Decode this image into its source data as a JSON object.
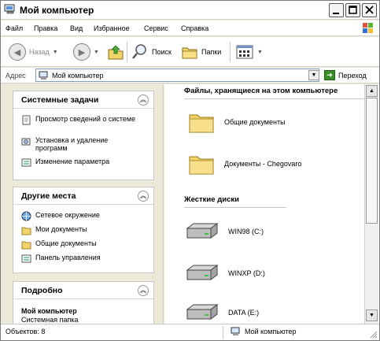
{
  "window": {
    "title": "Мой компьютер",
    "buttons": {
      "minimize": "minimize",
      "maximize": "maximize",
      "close": "close"
    }
  },
  "menu": [
    "Файл",
    "Правка",
    "Вид",
    "Избранное",
    "Сервис",
    "Справка"
  ],
  "toolbar": {
    "back": "Назад",
    "forward": "",
    "up": "",
    "search": "Поиск",
    "folders": "Папки",
    "views": ""
  },
  "address": {
    "label": "Адрес",
    "value": "Мой компьютер",
    "go": "Переход"
  },
  "left": {
    "system_tasks": {
      "title": "Системные задачи",
      "items": [
        "Просмотр сведений о системе",
        "Установка и удаление программ",
        "Изменение параметра"
      ]
    },
    "other_places": {
      "title": "Другие места",
      "items": [
        "Сетевое окружение",
        "Мои документы",
        "Общие документы",
        "Панель управления"
      ]
    },
    "details": {
      "title": "Подробно",
      "name": "Мой компьютер",
      "type": "Системная папка"
    }
  },
  "right": {
    "files_header": "Файлы, хранящиеся на этом компьютере",
    "files": [
      "Общие документы",
      "Документы - Chegovaro"
    ],
    "drives_header": "Жесткие диски",
    "drives": [
      "WIN98 (C:)",
      "WINXP (D:)",
      "DATA (E:)"
    ]
  },
  "status": {
    "objects": "Объектов: 8",
    "location": "Мой компьютер"
  }
}
